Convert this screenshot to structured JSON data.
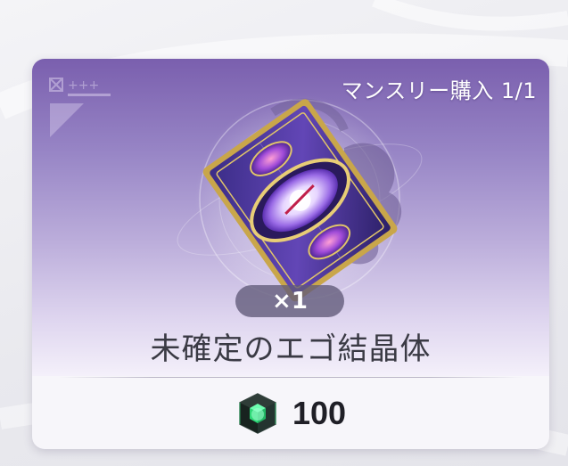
{
  "shop_item": {
    "purchase_limit": "マンスリー購入 1/1",
    "quantity": "×1",
    "name": "未確定のエゴ結晶体",
    "price": "100",
    "item_icon": "ego-crystal-card-icon",
    "currency_icon": "green-crystal-cube-icon",
    "colors": {
      "header_purple": "#7a5fae",
      "badge_gray": "#605a78",
      "name_text": "#3a3a44",
      "currency_green": "#3df28a"
    }
  }
}
